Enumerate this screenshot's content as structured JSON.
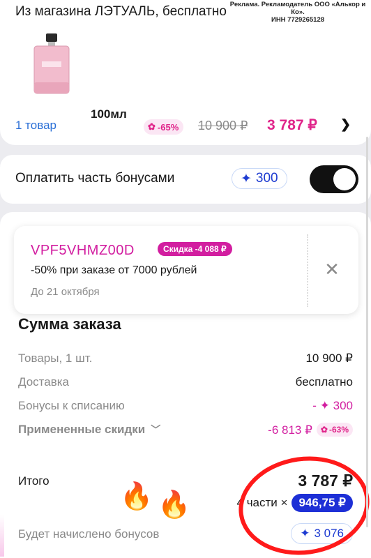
{
  "product": {
    "store_line": "Из магазина ЛЭТУАЛЬ, бесплатно",
    "ad_line1": "Реклама. Рекламодатель ООО «Алькор и Ко».",
    "ad_line2": "ИНН 7729265128",
    "volume": "100мл",
    "items_link": "1 товар",
    "discount": "-65%",
    "old_price": "10 900 ₽",
    "new_price": "3 787 ₽"
  },
  "bonus": {
    "label": "Оплатить часть бонусами",
    "amount": "300",
    "toggle_on": true
  },
  "promo": {
    "code": "VPF5VHMZ00D",
    "badge": "Скидка -4 088 ₽",
    "description": "-50% при заказе от 7000 рублей",
    "valid_until": "До 21 октября"
  },
  "summary": {
    "title": "Сумма заказа",
    "rows": [
      {
        "label": "Товары, 1 шт.",
        "value": "10 900 ₽"
      },
      {
        "label": "Доставка",
        "value": "бесплатно"
      },
      {
        "label": "Бонусы к списанию",
        "value": "- ✦ 300"
      },
      {
        "label": "Примененные скидки",
        "value": "-6 813 ₽",
        "badge": "-63%"
      }
    ],
    "total_label": "Итого",
    "total_value": "3 787 ₽",
    "installments_prefix": "4 части × ",
    "installments_value": "946,75 ₽",
    "bonus_earn_label": "Будет начислено бонусов",
    "bonus_earn_value": "3 076"
  },
  "colors": {
    "accent_pink": "#d21ea0",
    "link_blue": "#2a6fd6",
    "bonus_blue": "#1d2fd6",
    "highlight_red": "#ff1a1a"
  }
}
